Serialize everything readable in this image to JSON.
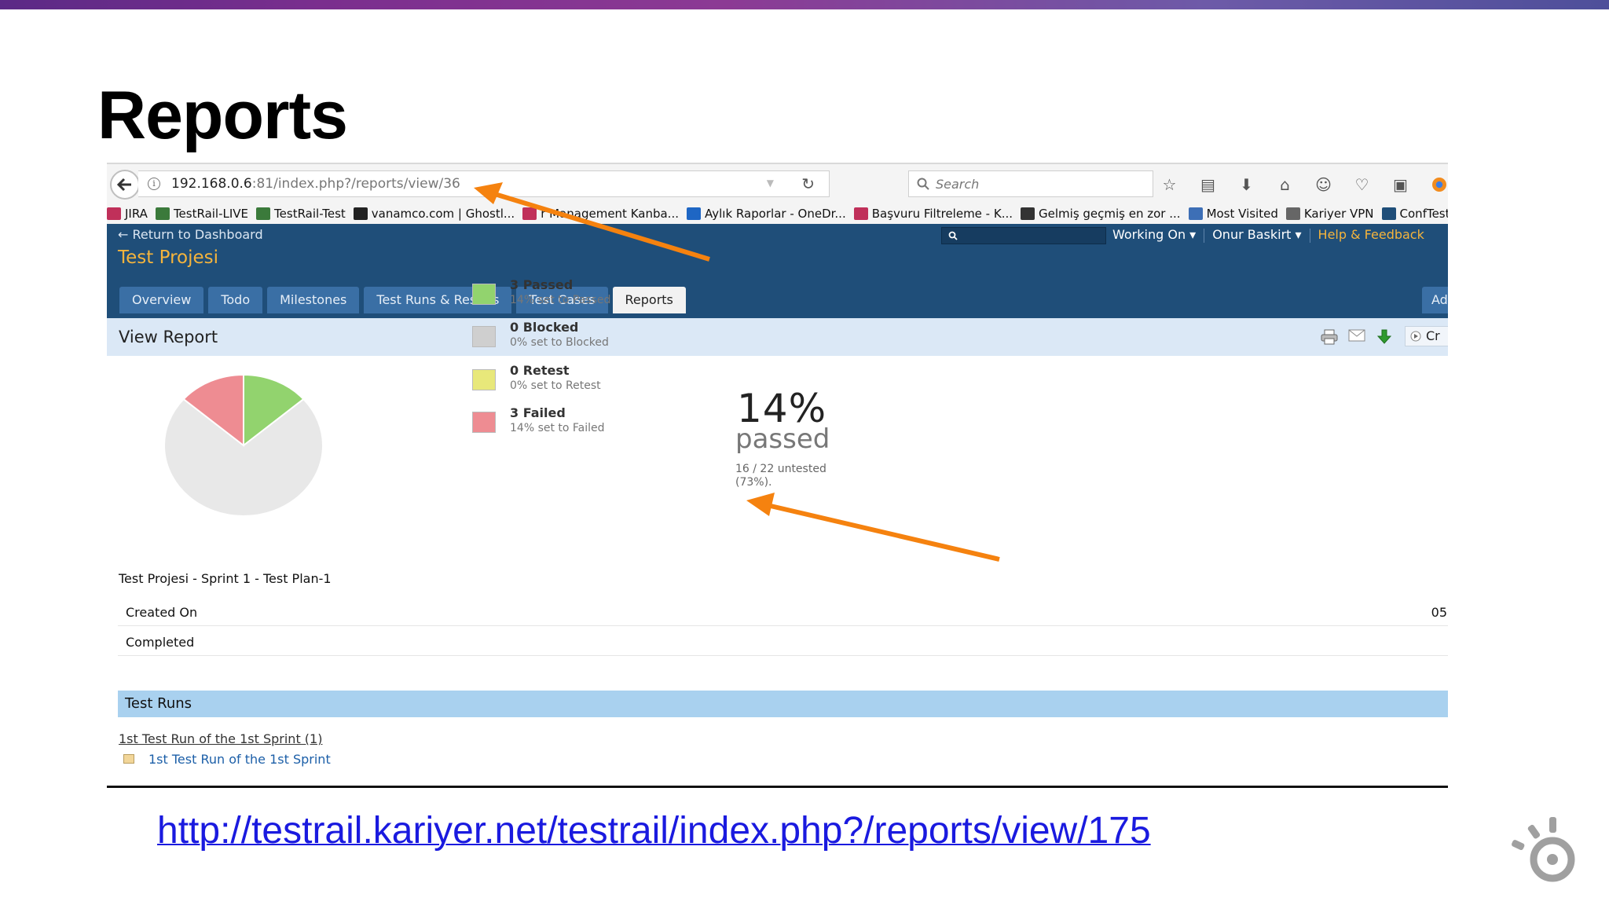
{
  "slide": {
    "title": "Reports",
    "link": "http://testrail.kariyer.net/testrail/index.php?/reports/view/175"
  },
  "browser": {
    "url_host": "192.168.0.6",
    "url_rest": ":81/index.php?/reports/view/36",
    "search_placeholder": "Search",
    "bookmarks": [
      {
        "label": "JIRA",
        "icon": "jira-icon",
        "color": "#c0305a"
      },
      {
        "label": "TestRail-LIVE",
        "icon": "testrail-icon",
        "color": "#3b7a3b"
      },
      {
        "label": "TestRail-Test",
        "icon": "testrail-icon",
        "color": "#3b7a3b"
      },
      {
        "label": "vanamco.com | Ghostl...",
        "icon": "v-icon",
        "color": "#222222"
      },
      {
        "label": "r Management Kanba...",
        "icon": "jira-icon",
        "color": "#c0305a"
      },
      {
        "label": "Aylık Raporlar - OneDr...",
        "icon": "cloud-icon",
        "color": "#1e66c4"
      },
      {
        "label": "Başvuru Filtreleme - K...",
        "icon": "jira-icon",
        "color": "#c0305a"
      },
      {
        "label": "Gelmiş geçmiş en zor ...",
        "icon": "wikipedia-icon",
        "color": "#333333"
      },
      {
        "label": "Most Visited",
        "icon": "most-visited-icon",
        "color": "#3d6fb6"
      },
      {
        "label": "Kariyer VPN",
        "icon": "globe-icon",
        "color": "#666666"
      },
      {
        "label": "ConfTest",
        "icon": "x-icon",
        "color": "#1f4e79"
      }
    ]
  },
  "app": {
    "return_link": "← Return to Dashboard",
    "project": "Test Projesi",
    "working_on": "Working On ▾",
    "user": "Onur Baskirt ▾",
    "help": "Help & Feedback",
    "tabs": [
      "Overview",
      "Todo",
      "Milestones",
      "Test Runs & Results",
      "Test Cases",
      "Reports"
    ],
    "active_tab": "Reports",
    "tab_cut": "Ad",
    "view_report_title": "View Report",
    "cr_label": "Cr"
  },
  "report": {
    "legend": [
      {
        "title": "3 Passed",
        "sub": "14% set to Passed",
        "color": "#92d36e"
      },
      {
        "title": "0 Blocked",
        "sub": "0% set to Blocked",
        "color": "#cfcfcf"
      },
      {
        "title": "0 Retest",
        "sub": "0% set to Retest",
        "color": "#e8e87a"
      },
      {
        "title": "3 Failed",
        "sub": "14% set to Failed",
        "color": "#ee8c92"
      }
    ],
    "percent": "14%",
    "percent_label": "passed",
    "untested": "16 / 22 untested (73%).",
    "plan_name": "Test Projesi - Sprint 1 - Test Plan-1",
    "created_on_label": "Created On",
    "created_on_value": "05",
    "completed_label": "Completed",
    "runs_header": "Test Runs",
    "run_group": "1st Test Run of the 1st Sprint (1)",
    "run_link": "1st Test Run of the 1st Sprint"
  },
  "chart_data": {
    "type": "pie",
    "categories": [
      "Passed",
      "Blocked",
      "Retest",
      "Failed",
      "Untested"
    ],
    "values": [
      3,
      0,
      0,
      3,
      16
    ],
    "colors": [
      "#92d36e",
      "#cfcfcf",
      "#e8e87a",
      "#ee8c92",
      "#e8e8e8"
    ]
  },
  "colors": {
    "header_blue": "#1f4e79",
    "accent_orange": "#f5b43c",
    "arrow_orange": "#f5820f",
    "link_blue": "#1a1adf"
  }
}
